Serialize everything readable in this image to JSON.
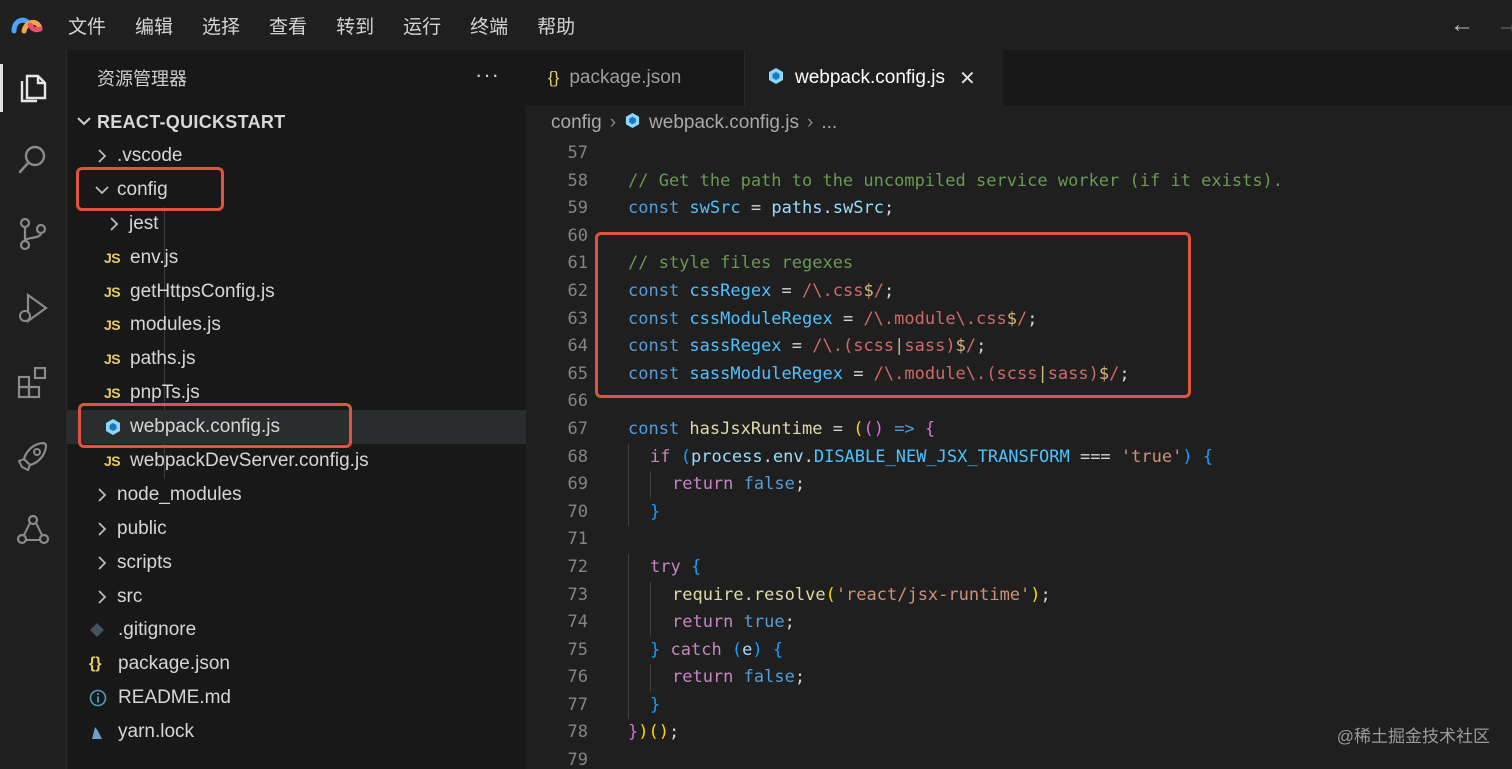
{
  "menu": [
    "文件",
    "编辑",
    "选择",
    "查看",
    "转到",
    "运行",
    "终端",
    "帮助"
  ],
  "nav": {
    "back": "←",
    "forward": "→"
  },
  "sidebar": {
    "title": "资源管理器",
    "more": "···",
    "project": "REACT-QUICKSTART",
    "tree": [
      {
        "label": ".vscode",
        "kind": "folder",
        "depth": 0,
        "open": false
      },
      {
        "label": "config",
        "kind": "folder",
        "depth": 0,
        "open": true
      },
      {
        "label": "jest",
        "kind": "folder",
        "depth": 1,
        "open": false
      },
      {
        "label": "env.js",
        "kind": "js",
        "depth": 1
      },
      {
        "label": "getHttpsConfig.js",
        "kind": "js",
        "depth": 1
      },
      {
        "label": "modules.js",
        "kind": "js",
        "depth": 1
      },
      {
        "label": "paths.js",
        "kind": "js",
        "depth": 1
      },
      {
        "label": "pnpTs.js",
        "kind": "js",
        "depth": 1
      },
      {
        "label": "webpack.config.js",
        "kind": "webpack",
        "depth": 1,
        "selected": true
      },
      {
        "label": "webpackDevServer.config.js",
        "kind": "js",
        "depth": 1
      },
      {
        "label": "node_modules",
        "kind": "folder",
        "depth": 0,
        "open": false
      },
      {
        "label": "public",
        "kind": "folder",
        "depth": 0,
        "open": false
      },
      {
        "label": "scripts",
        "kind": "folder",
        "depth": 0,
        "open": false
      },
      {
        "label": "src",
        "kind": "folder",
        "depth": 0,
        "open": false
      },
      {
        "label": ".gitignore",
        "kind": "git",
        "depth": 0
      },
      {
        "label": "package.json",
        "kind": "json",
        "depth": 0
      },
      {
        "label": "README.md",
        "kind": "info",
        "depth": 0
      },
      {
        "label": "yarn.lock",
        "kind": "yarn",
        "depth": 0
      }
    ]
  },
  "tabs": [
    {
      "label": "package.json",
      "icon": "{}",
      "active": false
    },
    {
      "label": "webpack.config.js",
      "icon": "webpack",
      "active": true,
      "close": "✕"
    }
  ],
  "breadcrumb": {
    "folder": "config",
    "file": "webpack.config.js",
    "more": "..."
  },
  "code": {
    "lines": [
      {
        "n": "57",
        "indent": 0,
        "tokens": []
      },
      {
        "n": "58",
        "indent": 0,
        "tokens": [
          [
            "cm",
            "// Get the path to the uncompiled service worker (if it exists)."
          ]
        ]
      },
      {
        "n": "59",
        "indent": 0,
        "tokens": [
          [
            "kw",
            "const "
          ],
          [
            "con",
            "swSrc"
          ],
          [
            "op",
            " = "
          ],
          [
            "var",
            "paths"
          ],
          [
            "op",
            "."
          ],
          [
            "var",
            "swSrc"
          ],
          [
            "op",
            ";"
          ]
        ]
      },
      {
        "n": "60",
        "indent": 0,
        "tokens": []
      },
      {
        "n": "61",
        "indent": 0,
        "tokens": [
          [
            "cm",
            "// style files regexes"
          ]
        ]
      },
      {
        "n": "62",
        "indent": 0,
        "tokens": [
          [
            "kw",
            "const "
          ],
          [
            "con",
            "cssRegex"
          ],
          [
            "op",
            " = "
          ],
          [
            "re",
            "/\\."
          ],
          [
            "re",
            "css"
          ],
          [
            "esc",
            "$"
          ],
          [
            "re",
            "/"
          ],
          [
            "op",
            ";"
          ]
        ]
      },
      {
        "n": "63",
        "indent": 0,
        "tokens": [
          [
            "kw",
            "const "
          ],
          [
            "con",
            "cssModuleRegex"
          ],
          [
            "op",
            " = "
          ],
          [
            "re",
            "/\\.module\\.css"
          ],
          [
            "esc",
            "$"
          ],
          [
            "re",
            "/"
          ],
          [
            "op",
            ";"
          ]
        ]
      },
      {
        "n": "64",
        "indent": 0,
        "tokens": [
          [
            "kw",
            "const "
          ],
          [
            "con",
            "sassRegex"
          ],
          [
            "op",
            " = "
          ],
          [
            "re",
            "/\\.(scss"
          ],
          [
            "esc",
            "|"
          ],
          [
            "re",
            "sass)"
          ],
          [
            "esc",
            "$"
          ],
          [
            "re",
            "/"
          ],
          [
            "op",
            ";"
          ]
        ]
      },
      {
        "n": "65",
        "indent": 0,
        "tokens": [
          [
            "kw",
            "const "
          ],
          [
            "con",
            "sassModuleRegex"
          ],
          [
            "op",
            " = "
          ],
          [
            "re",
            "/\\.module\\.(scss"
          ],
          [
            "esc",
            "|"
          ],
          [
            "re",
            "sass)"
          ],
          [
            "esc",
            "$"
          ],
          [
            "re",
            "/"
          ],
          [
            "op",
            ";"
          ]
        ]
      },
      {
        "n": "66",
        "indent": 0,
        "tokens": []
      },
      {
        "n": "67",
        "indent": 0,
        "tokens": [
          [
            "kw",
            "const "
          ],
          [
            "fn",
            "hasJsxRuntime"
          ],
          [
            "op",
            " = "
          ],
          [
            "br1",
            "("
          ],
          [
            "br2",
            "()"
          ],
          [
            "op",
            " "
          ],
          [
            "kw",
            "=>"
          ],
          [
            "op",
            " "
          ],
          [
            "br2",
            "{"
          ]
        ]
      },
      {
        "n": "68",
        "indent": 1,
        "tokens": [
          [
            "ctl",
            "if "
          ],
          [
            "br3",
            "("
          ],
          [
            "var",
            "process"
          ],
          [
            "op",
            "."
          ],
          [
            "var",
            "env"
          ],
          [
            "op",
            "."
          ],
          [
            "con",
            "DISABLE_NEW_JSX_TRANSFORM"
          ],
          [
            "op",
            " === "
          ],
          [
            "str",
            "'true'"
          ],
          [
            "br3",
            ")"
          ],
          [
            "op",
            " "
          ],
          [
            "br3",
            "{"
          ]
        ]
      },
      {
        "n": "69",
        "indent": 2,
        "tokens": [
          [
            "ctl",
            "return "
          ],
          [
            "kw",
            "false"
          ],
          [
            "op",
            ";"
          ]
        ]
      },
      {
        "n": "70",
        "indent": 1,
        "tokens": [
          [
            "br3",
            "}"
          ]
        ]
      },
      {
        "n": "71",
        "indent": 0,
        "tokens": []
      },
      {
        "n": "72",
        "indent": 1,
        "tokens": [
          [
            "ctl",
            "try "
          ],
          [
            "br3",
            "{"
          ]
        ]
      },
      {
        "n": "73",
        "indent": 2,
        "tokens": [
          [
            "fn",
            "require"
          ],
          [
            "op",
            "."
          ],
          [
            "fn",
            "resolve"
          ],
          [
            "br1",
            "("
          ],
          [
            "str",
            "'react/jsx-runtime'"
          ],
          [
            "br1",
            ")"
          ],
          [
            "op",
            ";"
          ]
        ]
      },
      {
        "n": "74",
        "indent": 2,
        "tokens": [
          [
            "ctl",
            "return "
          ],
          [
            "kw",
            "true"
          ],
          [
            "op",
            ";"
          ]
        ]
      },
      {
        "n": "75",
        "indent": 1,
        "tokens": [
          [
            "br3",
            "}"
          ],
          [
            "op",
            " "
          ],
          [
            "ctl",
            "catch "
          ],
          [
            "br3",
            "("
          ],
          [
            "var",
            "e"
          ],
          [
            "br3",
            ")"
          ],
          [
            "op",
            " "
          ],
          [
            "br3",
            "{"
          ]
        ]
      },
      {
        "n": "76",
        "indent": 2,
        "tokens": [
          [
            "ctl",
            "return "
          ],
          [
            "kw",
            "false"
          ],
          [
            "op",
            ";"
          ]
        ]
      },
      {
        "n": "77",
        "indent": 1,
        "tokens": [
          [
            "br3",
            "}"
          ]
        ]
      },
      {
        "n": "78",
        "indent": 0,
        "tokens": [
          [
            "br2",
            "}"
          ],
          [
            "br1",
            ")"
          ],
          [
            "br1",
            "()"
          ],
          [
            "op",
            ";"
          ]
        ]
      },
      {
        "n": "79",
        "indent": 0,
        "tokens": []
      }
    ]
  },
  "watermark": "@稀土掘金技术社区",
  "colors": {
    "highlight": "#e0533f",
    "accent": "#007acc"
  }
}
